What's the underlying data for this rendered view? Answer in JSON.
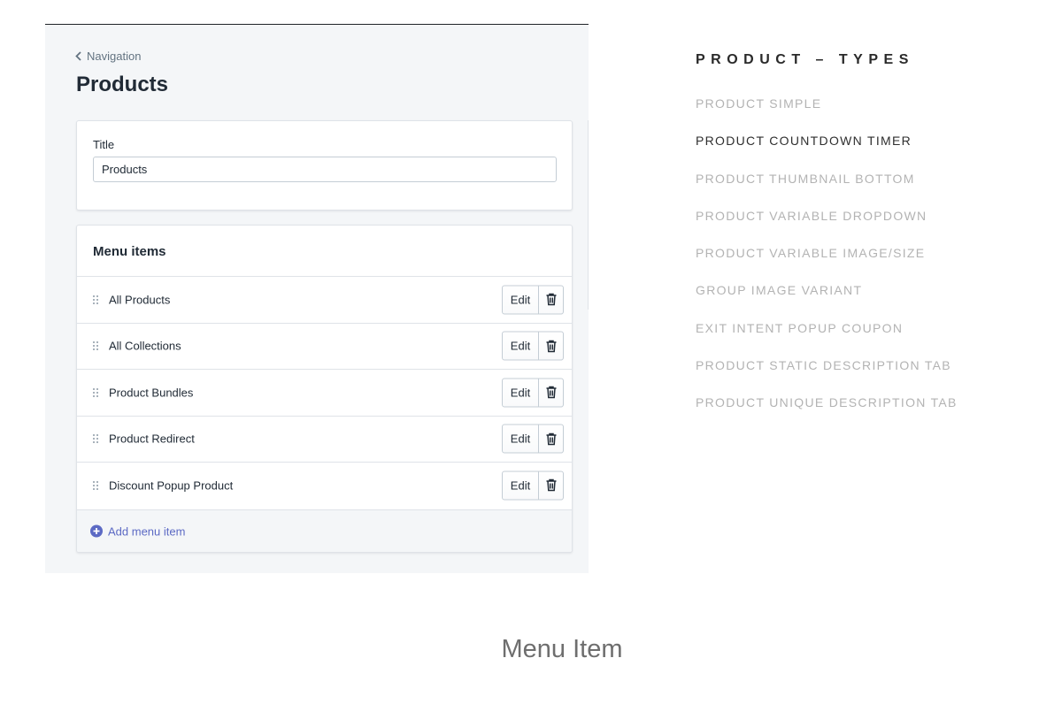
{
  "admin": {
    "breadcrumb_label": "Navigation",
    "page_title": "Products",
    "title_card": {
      "label": "Title",
      "input_value": "Products"
    },
    "menu_card": {
      "heading": "Menu items",
      "items": [
        {
          "label": "All Products",
          "edit_label": "Edit"
        },
        {
          "label": "All Collections",
          "edit_label": "Edit"
        },
        {
          "label": "Product Bundles",
          "edit_label": "Edit"
        },
        {
          "label": "Product Redirect",
          "edit_label": "Edit"
        },
        {
          "label": "Discount Popup Product",
          "edit_label": "Edit"
        }
      ],
      "add_label": "Add menu item"
    }
  },
  "product_types": {
    "title": "PRODUCT – TYPES",
    "items": [
      {
        "label": "PRODUCT SIMPLE",
        "active": false
      },
      {
        "label": "PRODUCT COUNTDOWN TIMER",
        "active": true
      },
      {
        "label": "PRODUCT THUMBNAIL BOTTOM",
        "active": false
      },
      {
        "label": "PRODUCT VARIABLE DROPDOWN",
        "active": false
      },
      {
        "label": "PRODUCT VARIABLE IMAGE/SIZE",
        "active": false
      },
      {
        "label": "GROUP IMAGE VARIANT",
        "active": false
      },
      {
        "label": "EXIT INTENT POPUP COUPON",
        "active": false
      },
      {
        "label": "PRODUCT STATIC DESCRIPTION TAB",
        "active": false
      },
      {
        "label": "PRODUCT UNIQUE DESCRIPTION TAB",
        "active": false
      }
    ]
  },
  "caption": "Menu Item",
  "icons": {
    "breadcrumb": "chevron-left-icon",
    "drag": "drag-handle-icon",
    "delete": "trash-icon",
    "add": "plus-circle-icon"
  },
  "colors": {
    "accent": "#5c6ac4",
    "panel_background": "#f4f6f8",
    "muted_text": "#637381",
    "active_type": "#2f2f2f",
    "inactive_type": "#b3b3b3"
  }
}
